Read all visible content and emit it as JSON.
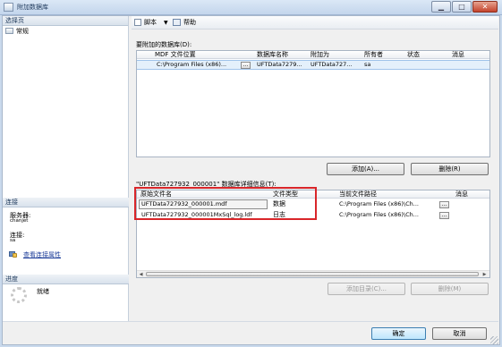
{
  "window": {
    "title": "附加数据库",
    "minimize_glyph": "▁",
    "maximize_glyph": "□",
    "close_glyph": "✕"
  },
  "left": {
    "select_page_header": "选择页",
    "page_general": "常规",
    "connection_header": "连接",
    "server_label": "服务器:",
    "server_value": "chanjet",
    "connection_label": "连接:",
    "connection_value": "sa",
    "view_properties_link": "查看连接属性",
    "progress_header": "进度",
    "progress_status": "就绪"
  },
  "toolbar": {
    "script_label": "脚本",
    "help_label": "帮助"
  },
  "attach_section": {
    "label": "要附加的数据库(D):",
    "columns": [
      "MDF 文件位置",
      "数据库名称",
      "附加为",
      "所有者",
      "状态",
      "消息"
    ],
    "rows": [
      {
        "mdf": "C:\\Program Files (x86)...",
        "ellipsis": "...",
        "db_name": "UFTData7279...",
        "attach_as": "UFTData727...",
        "owner": "sa",
        "status": "",
        "message": ""
      }
    ],
    "add_button": "添加(A)...",
    "remove_button": "删除(R)"
  },
  "details_section": {
    "label": "\"UFTData727932_000001\" 数据库详细信息(T):",
    "columns": [
      "原始文件名",
      "文件类型",
      "当前文件路径",
      "消息"
    ],
    "rows": [
      {
        "file": "UFTData727932_000001.mdf",
        "type": "数据",
        "path": "C:\\Program Files (x86)\\Ch...",
        "ellipsis": "..."
      },
      {
        "file": "UFTData727932_000001MxSql_log.ldf",
        "type": "日志",
        "path": "C:\\Program Files (x86)\\Ch...",
        "ellipsis": "..."
      }
    ],
    "add_catalog_button": "添加目录(C)...",
    "remove_button": "删除(M)"
  },
  "footer": {
    "ok_button": "确定",
    "cancel_button": "取消"
  },
  "colors": {
    "highlight_box": "#d9262a",
    "selected_row": "#e4f0fb",
    "link": "#1f3f9a"
  }
}
